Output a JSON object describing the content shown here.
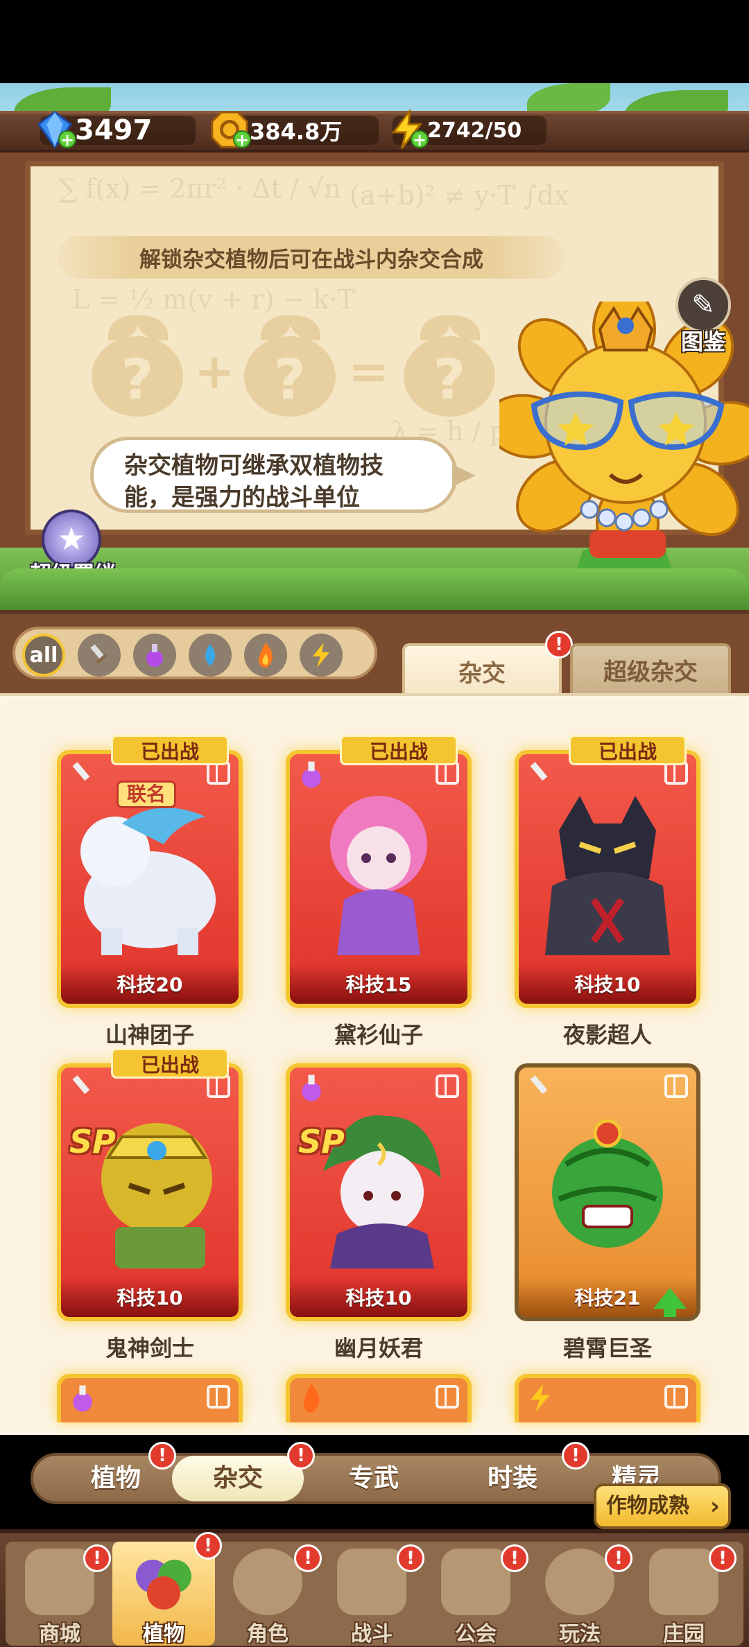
{
  "currencies": {
    "gems": "3497",
    "coins": "384.8万",
    "energy": "2742/50"
  },
  "board": {
    "unlock_hint": "解锁杂交植物后可在战斗内杂交合成",
    "formula_unknown": "?",
    "speech": "杂交植物可继承双植物技能，是强力的战斗单位",
    "speech_line1": "杂交植物可继承双植物技",
    "speech_line2": "能，是强力的战斗单位",
    "codex_label": "图鉴",
    "super_bond_label": "超级羁绊"
  },
  "filters": {
    "all_label": "all",
    "types": [
      "sword",
      "potion",
      "water",
      "fire",
      "lightning"
    ],
    "selected": "all"
  },
  "tabs": {
    "hybrid": "杂交",
    "super_hybrid": "超级杂交",
    "active": "hybrid",
    "badge": "!"
  },
  "cards": [
    {
      "name": "山神团子",
      "level": "科技20",
      "deployed": "已出战",
      "tag": "联名",
      "element": "sword-icon",
      "rarity": "red"
    },
    {
      "name": "黛衫仙子",
      "level": "科技15",
      "deployed": "已出战",
      "element": "potion-icon",
      "rarity": "red"
    },
    {
      "name": "夜影超人",
      "level": "科技10",
      "deployed": "已出战",
      "element": "sword-icon",
      "rarity": "red"
    },
    {
      "name": "鬼神剑士",
      "level": "科技10",
      "deployed": "已出战",
      "tag": "SP",
      "element": "sword-icon",
      "rarity": "red"
    },
    {
      "name": "幽月妖君",
      "level": "科技10",
      "tag": "SP",
      "element": "potion-icon",
      "rarity": "red"
    },
    {
      "name": "碧霄巨圣",
      "level": "科技21",
      "element": "sword-icon",
      "rarity": "gold",
      "upgradable": true
    }
  ],
  "partial_cards": [
    "potion-icon",
    "fire-icon",
    "lightning-icon"
  ],
  "subtabs": {
    "items": [
      "植物",
      "杂交",
      "专武",
      "时装",
      "精灵"
    ],
    "active": "杂交"
  },
  "harvest_button": "作物成熟",
  "nav": {
    "items": [
      "商城",
      "植物",
      "角色",
      "战斗",
      "公会",
      "玩法",
      "庄园"
    ],
    "active": "植物"
  },
  "colors": {
    "accent_gold": "#f4c531",
    "card_red": "#e0332b",
    "badge_red": "#e23b2e",
    "wood": "#7b4a2e"
  }
}
